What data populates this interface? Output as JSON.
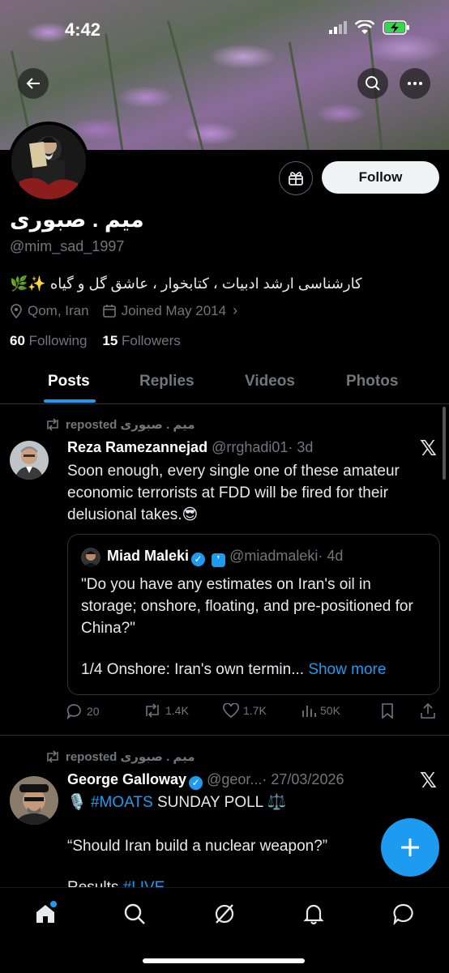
{
  "status_bar": {
    "time": "4:42"
  },
  "profile": {
    "name": "میم . صبوری",
    "handle": "@mim_sad_1997",
    "bio": "🌿✨ کارشناسی ارشد ادبیات ، کتابخوار ، عاشق گل و گیاه",
    "location": "Qom, Iran",
    "joined": "Joined May 2014",
    "following_count": "60",
    "following_label": "Following",
    "followers_count": "15",
    "followers_label": "Followers",
    "follow_label": "Follow"
  },
  "tabs": [
    "Posts",
    "Replies",
    "Videos",
    "Photos"
  ],
  "posts": [
    {
      "repost_label": "reposted میم . صبوری",
      "author": "Reza Ramezannejad",
      "handle": "@rrghadi01",
      "time": "· 3d",
      "text": "Soon enough, every single one of these amateur economic terrorists at FDD will be fired for their delusional takes.😎",
      "quote": {
        "author": "Miad Maleki",
        "handle": "@miadmaleki",
        "time": "· 4d",
        "text": "\"Do you have any estimates on Iran's oil in storage; onshore, floating, and pre-positioned for China?\"",
        "text2": "1/4 Onshore: Iran's own termin...",
        "show_more": "Show more"
      },
      "replies": "20",
      "reposts": "1.4K",
      "likes": "1.7K",
      "views": "50K"
    },
    {
      "repost_label": "reposted میم . صبوری",
      "author": "George Galloway",
      "handle": "@geor...",
      "time": "· 27/03/2026",
      "hashtag": "#MOATS",
      "line1_rest": " SUNDAY POLL ⚖️",
      "line2": "“Should Iran build a nuclear weapon?”",
      "line3": "Results",
      "line3_tag": "#LIVE"
    }
  ],
  "colors": {
    "accent": "#1d9bf0",
    "muted": "#71767b",
    "border": "#2f3336"
  }
}
